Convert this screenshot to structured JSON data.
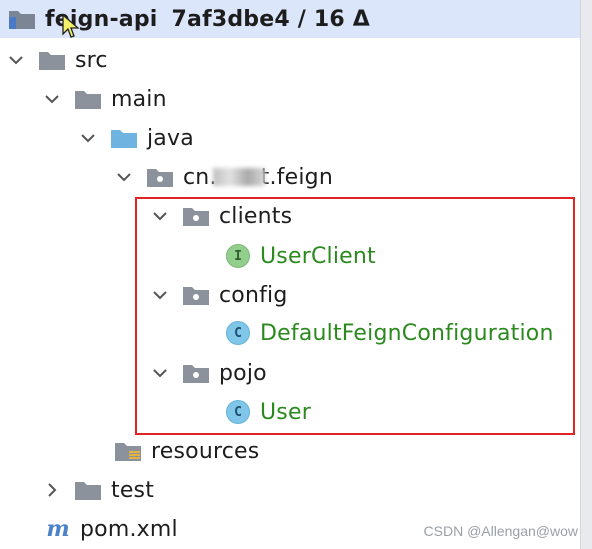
{
  "header": {
    "project_name": "feign-api",
    "vcs_info": "7af3dbe4 / 16 Δ"
  },
  "tree": {
    "src": "src",
    "main": "main",
    "java": "java",
    "package_prefix": "cn.",
    "package_suffix": "t.feign",
    "clients": "clients",
    "user_client": "UserClient",
    "config": "config",
    "default_feign_configuration": "DefaultFeignConfiguration",
    "pojo": "pojo",
    "user": "User",
    "resources": "resources",
    "test": "test",
    "pom": "pom.xml"
  },
  "icons": {
    "interface_letter": "I",
    "class_letter": "C",
    "maven_letter": "m"
  },
  "watermark": "CSDN @Allengan@wow",
  "colors": {
    "selection": "#dbe6fb",
    "highlight_border": "#e02424",
    "class_name_green": "#2b8a1e",
    "folder_gray": "#8c929c",
    "source_folder_blue": "#6fb3e0"
  }
}
